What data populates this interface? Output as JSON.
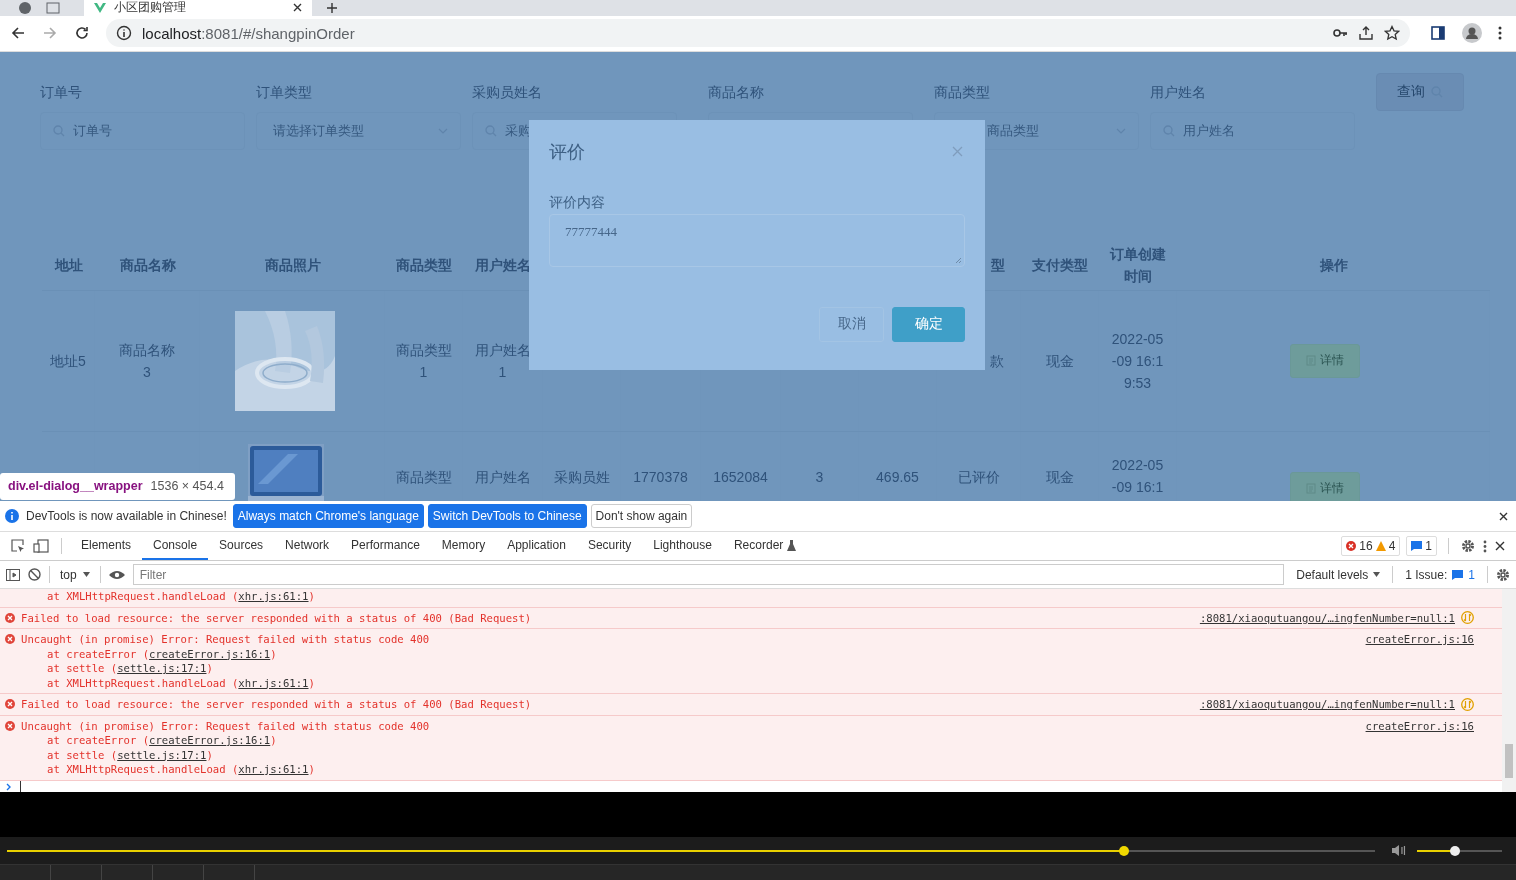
{
  "browser": {
    "tab_title": "小区团购管理",
    "url_host": "localhost",
    "url_path": ":8081/#/shangpinOrder"
  },
  "filters": [
    {
      "label": "订单号",
      "kind": "search",
      "placeholder": "订单号"
    },
    {
      "label": "订单类型",
      "kind": "select",
      "placeholder": "请选择订单类型"
    },
    {
      "label": "采购员姓名",
      "kind": "search",
      "placeholder": "采购"
    },
    {
      "label": "商品名称",
      "kind": "covered"
    },
    {
      "label": "商品类型",
      "kind": "select",
      "placeholder": "商品类型",
      "clipped": true
    },
    {
      "label": "用户姓名",
      "kind": "search",
      "placeholder": "用户姓名"
    }
  ],
  "query_button": "查询",
  "table": {
    "columns": [
      {
        "label": "地址"
      },
      {
        "label": "商品名称"
      },
      {
        "label": "商品照片"
      },
      {
        "label": "商品类型"
      },
      {
        "label": "用户姓名"
      },
      {},
      {},
      {},
      {},
      {},
      {
        "label": "型",
        "clipped": true
      },
      {
        "label": "支付类型"
      },
      {
        "label": "订单创建时间"
      },
      {
        "label": "操作"
      }
    ],
    "rows": [
      {
        "cells": [
          {
            "kind": "text",
            "text": "地址5"
          },
          {
            "kind": "text",
            "text": "商品名称3"
          },
          {
            "kind": "picture"
          },
          {
            "kind": "text",
            "text": "商品类型1"
          },
          {
            "kind": "text",
            "text": "用户姓名1"
          },
          {
            "kind": "covered"
          },
          {
            "kind": "covered"
          },
          {
            "kind": "covered"
          },
          {
            "kind": "covered"
          },
          {
            "kind": "covered"
          },
          {
            "kind": "text",
            "text": "款",
            "clipped": true
          },
          {
            "kind": "text",
            "text": "现金"
          },
          {
            "kind": "text",
            "text": "2022-05-09 16:19:53"
          },
          {
            "kind": "button",
            "text": "详情"
          }
        ]
      },
      {
        "cells": [
          {
            "kind": "covered"
          },
          {
            "kind": "covered"
          },
          {
            "kind": "picture"
          },
          {
            "kind": "text",
            "text": "商品类型"
          },
          {
            "kind": "text",
            "text": "用户姓名"
          },
          {
            "kind": "text",
            "text": "采购员姓"
          },
          {
            "kind": "text",
            "text": "1770378"
          },
          {
            "kind": "text",
            "text": "1652084"
          },
          {
            "kind": "text",
            "text": "3"
          },
          {
            "kind": "text",
            "text": "469.65"
          },
          {
            "kind": "text",
            "text": "已评价"
          },
          {
            "kind": "text",
            "text": "现金"
          },
          {
            "kind": "text",
            "text": "2022-05-09 16:1"
          },
          {
            "kind": "button",
            "text": "详情"
          }
        ]
      }
    ]
  },
  "dialog": {
    "title": "评价",
    "field_label": "评价内容",
    "value": "77777444",
    "buttons": [
      {
        "label": "取消",
        "kind": "default"
      },
      {
        "label": "确定",
        "kind": "primary"
      }
    ]
  },
  "inspect_tooltip": {
    "selector": "div.el-dialog__wrapper",
    "size": "1536 × 454.4"
  },
  "devtools": {
    "banner": {
      "text": "DevTools is now available in Chinese!",
      "buttons": [
        {
          "label": "Always match Chrome's language",
          "kind": "primary"
        },
        {
          "label": "Switch DevTools to Chinese",
          "kind": "primary"
        },
        {
          "label": "Don't show again",
          "kind": "plain"
        }
      ]
    },
    "tabs": [
      {
        "label": "Elements",
        "selected": false
      },
      {
        "label": "Console",
        "selected": true
      },
      {
        "label": "Sources",
        "selected": false
      },
      {
        "label": "Network",
        "selected": false
      },
      {
        "label": "Performance",
        "selected": false
      },
      {
        "label": "Memory",
        "selected": false
      },
      {
        "label": "Application",
        "selected": false
      },
      {
        "label": "Security",
        "selected": false
      },
      {
        "label": "Lighthouse",
        "selected": false
      },
      {
        "label": "Recorder",
        "selected": false
      }
    ],
    "errors": "16",
    "warnings": "4",
    "messages": "1",
    "context": "top",
    "filter_placeholder": "Filter",
    "levels": "Default levels",
    "issues": {
      "label": "1 Issue:",
      "count": "1"
    },
    "console": [
      {
        "kind": "trace",
        "lines": [
          {
            "text": "at XMLHttpRequest.handleLoad (",
            "link": "xhr.js:61:1",
            "end": ")"
          }
        ]
      },
      {
        "kind": "network",
        "text": "Failed to load resource: the server responded with a status of 400 (Bad Request)",
        "source": ":8081/xiaoqutuangou/…ingfenNumber=null:1"
      },
      {
        "kind": "error",
        "text": "Uncaught (in promise) Error: Request failed with status code 400",
        "source": "createError.js:16",
        "lines": [
          {
            "text": "at createError (",
            "link": "createError.js:16:1",
            "end": ")"
          },
          {
            "text": "at settle (",
            "link": "settle.js:17:1",
            "end": ")"
          },
          {
            "text": "at XMLHttpRequest.handleLoad (",
            "link": "xhr.js:61:1",
            "end": ")"
          }
        ]
      },
      {
        "kind": "network",
        "text": "Failed to load resource: the server responded with a status of 400 (Bad Request)",
        "source": ":8081/xiaoqutuangou/…ingfenNumber=null:1"
      },
      {
        "kind": "error",
        "text": "Uncaught (in promise) Error: Request failed with status code 400",
        "source": "createError.js:16",
        "lines": [
          {
            "text": "at createError (",
            "link": "createError.js:16:1",
            "end": ")"
          },
          {
            "text": "at settle (",
            "link": "settle.js:17:1",
            "end": ")"
          },
          {
            "text": "at XMLHttpRequest.handleLoad (",
            "link": "xhr.js:61:1",
            "end": ")"
          }
        ]
      }
    ]
  }
}
